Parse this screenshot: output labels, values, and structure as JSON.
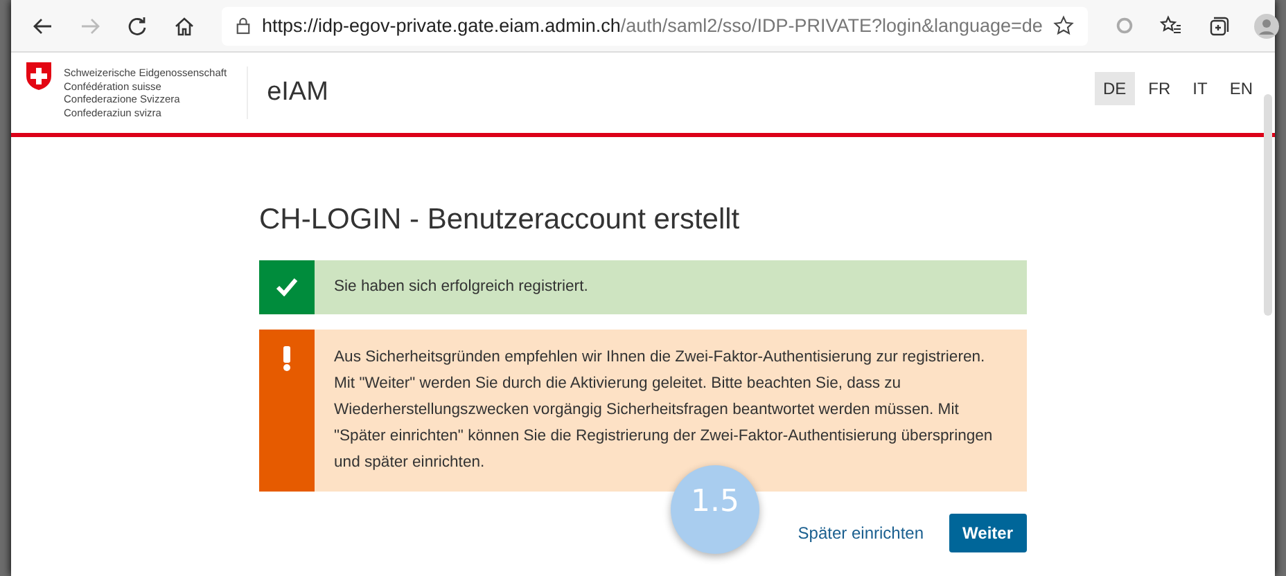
{
  "browser": {
    "url_host": "https://idp-egov-private.gate.eiam.admin.ch",
    "url_path": "/auth/saml2/sso/IDP-PRIVATE?login&language=de"
  },
  "header": {
    "confederation": [
      "Schweizerische Eidgenossenschaft",
      "Confédération suisse",
      "Confederazione Svizzera",
      "Confederaziun svizra"
    ],
    "app_name": "eIAM",
    "languages": [
      {
        "label": "DE",
        "selected": true
      },
      {
        "label": "FR",
        "selected": false
      },
      {
        "label": "IT",
        "selected": false
      },
      {
        "label": "EN",
        "selected": false
      }
    ]
  },
  "title": "CH-LOGIN - Benutzeraccount erstellt",
  "messages": [
    {
      "kind": "success",
      "text": "Sie haben sich erfolgreich registriert."
    },
    {
      "kind": "warning",
      "text": "Aus Sicherheitsgründen empfehlen wir Ihnen die Zwei-Faktor-Authentisierung zur registrieren. Mit \"Weiter\" werden Sie durch die Aktivierung geleitet. Bitte beachten Sie, dass zu Wiederherstellungszwecken vorgängig Sicherheitsfragen beantwortet werden müssen. Mit \"Später einrichten\" können Sie die Registrierung der Zwei-Faktor-Authentisierung überspringen und später einrichten."
    }
  ],
  "actions": {
    "later": "Später einrichten",
    "next": "Weiter"
  },
  "callout": "1.5"
}
